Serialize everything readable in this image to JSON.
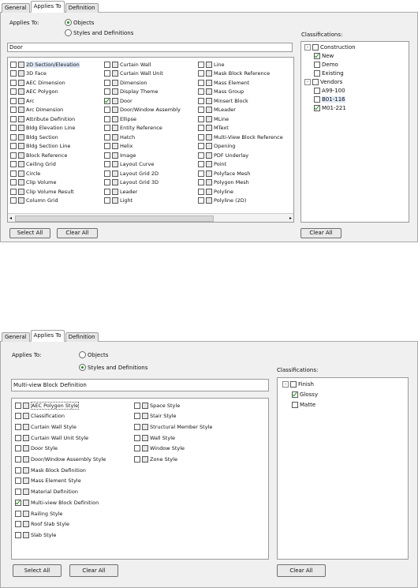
{
  "tabs": [
    "General",
    "Applies To",
    "Definition"
  ],
  "top": {
    "applies_label": "Applies To:",
    "radio_objects": "Objects",
    "radio_styles": "Styles and Definitions",
    "selected_radio": "Objects",
    "search_value": "Door",
    "classifications_label": "Classifications:",
    "col1": [
      {
        "label": "2D Section/Elevation",
        "checked": false
      },
      {
        "label": "3D Face",
        "checked": false
      },
      {
        "label": "AEC Dimension",
        "checked": false
      },
      {
        "label": "AEC Polygon",
        "checked": false
      },
      {
        "label": "Arc",
        "checked": false
      },
      {
        "label": "Arc Dimension",
        "checked": false
      },
      {
        "label": "Attribute Definition",
        "checked": false
      },
      {
        "label": "Bldg Elevation Line",
        "checked": false
      },
      {
        "label": "Bldg Section",
        "checked": false
      },
      {
        "label": "Bldg Section Line",
        "checked": false
      },
      {
        "label": "Block Reference",
        "checked": false
      },
      {
        "label": "Ceiling Grid",
        "checked": false
      },
      {
        "label": "Circle",
        "checked": false
      },
      {
        "label": "Clip Volume",
        "checked": false
      },
      {
        "label": "Clip Volume Result",
        "checked": false
      },
      {
        "label": "Column Grid",
        "checked": false
      }
    ],
    "col2": [
      {
        "label": "Curtain Wall",
        "checked": false
      },
      {
        "label": "Curtain Wall Unit",
        "checked": false
      },
      {
        "label": "Dimension",
        "checked": false
      },
      {
        "label": "Display Theme",
        "checked": false
      },
      {
        "label": "Door",
        "checked": true
      },
      {
        "label": "Door/Window Assembly",
        "checked": false
      },
      {
        "label": "Ellipse",
        "checked": false
      },
      {
        "label": "Entity Reference",
        "checked": false
      },
      {
        "label": "Hatch",
        "checked": false
      },
      {
        "label": "Helix",
        "checked": false
      },
      {
        "label": "Image",
        "checked": false
      },
      {
        "label": "Layout Curve",
        "checked": false
      },
      {
        "label": "Layout Grid 2D",
        "checked": false
      },
      {
        "label": "Layout Grid 3D",
        "checked": false
      },
      {
        "label": "Leader",
        "checked": false
      },
      {
        "label": "Light",
        "checked": false
      }
    ],
    "col3": [
      {
        "label": "Line",
        "checked": false
      },
      {
        "label": "Mask Block Reference",
        "checked": false
      },
      {
        "label": "Mass Element",
        "checked": false
      },
      {
        "label": "Mass Group",
        "checked": false
      },
      {
        "label": "Minsert Block",
        "checked": false
      },
      {
        "label": "MLeader",
        "checked": false
      },
      {
        "label": "MLine",
        "checked": false
      },
      {
        "label": "MText",
        "checked": false
      },
      {
        "label": "Multi-View Block Reference",
        "checked": false
      },
      {
        "label": "Opening",
        "checked": false
      },
      {
        "label": "PDF Underlay",
        "checked": false
      },
      {
        "label": "Point",
        "checked": false
      },
      {
        "label": "Polyface Mesh",
        "checked": false
      },
      {
        "label": "Polygon Mesh",
        "checked": false
      },
      {
        "label": "Polyline",
        "checked": false
      },
      {
        "label": "Polyline (2D)",
        "checked": false
      }
    ],
    "tree": [
      {
        "label": "Construction",
        "level": 0,
        "checked": false,
        "expander": "-"
      },
      {
        "label": "New",
        "level": 1,
        "checked": true
      },
      {
        "label": "Demo",
        "level": 1,
        "checked": false
      },
      {
        "label": "Existing",
        "level": 1,
        "checked": false
      },
      {
        "label": "Vendors",
        "level": 0,
        "checked": false,
        "expander": "-"
      },
      {
        "label": "A99-100",
        "level": 1,
        "checked": false
      },
      {
        "label": "B01-116",
        "level": 1,
        "checked": false
      },
      {
        "label": "M01-221",
        "level": 1,
        "checked": true
      }
    ],
    "select_all": "Select All",
    "clear_all": "Clear All",
    "clear_all_right": "Clear All"
  },
  "bottom": {
    "applies_label": "Applies To:",
    "radio_objects": "Objects",
    "radio_styles": "Styles and Definitions",
    "selected_radio": "Styles and Definitions",
    "search_value": "Multi-view Block Definition",
    "classifications_label": "Classifications:",
    "col1": [
      {
        "label": "AEC Polygon Style",
        "checked": false
      },
      {
        "label": "Classification",
        "checked": false
      },
      {
        "label": "Curtain Wall Style",
        "checked": false
      },
      {
        "label": "Curtain Wall Unit Style",
        "checked": false
      },
      {
        "label": "Door Style",
        "checked": false
      },
      {
        "label": "Door/Window Assembly Style",
        "checked": false
      },
      {
        "label": "Mask Block Definition",
        "checked": false
      },
      {
        "label": "Mass Element Style",
        "checked": false
      },
      {
        "label": "Material Definition",
        "checked": false
      },
      {
        "label": "Multi-view Block Definition",
        "checked": true
      },
      {
        "label": "Railing Style",
        "checked": false
      },
      {
        "label": "Roof Slab Style",
        "checked": false
      },
      {
        "label": "Slab Style",
        "checked": false
      }
    ],
    "col2": [
      {
        "label": "Space Style",
        "checked": false
      },
      {
        "label": "Stair Style",
        "checked": false
      },
      {
        "label": "Structural Member Style",
        "checked": false
      },
      {
        "label": "Wall Style",
        "checked": false
      },
      {
        "label": "Window Style",
        "checked": false
      },
      {
        "label": "Zone Style",
        "checked": false
      }
    ],
    "tree": [
      {
        "label": "Finish",
        "level": 0,
        "checked": false,
        "expander": "-"
      },
      {
        "label": "Glossy",
        "level": 1,
        "checked": true
      },
      {
        "label": "Matte",
        "level": 1,
        "checked": false
      }
    ],
    "select_all": "Select All",
    "clear_all": "Clear All",
    "clear_all_right": "Clear All"
  }
}
